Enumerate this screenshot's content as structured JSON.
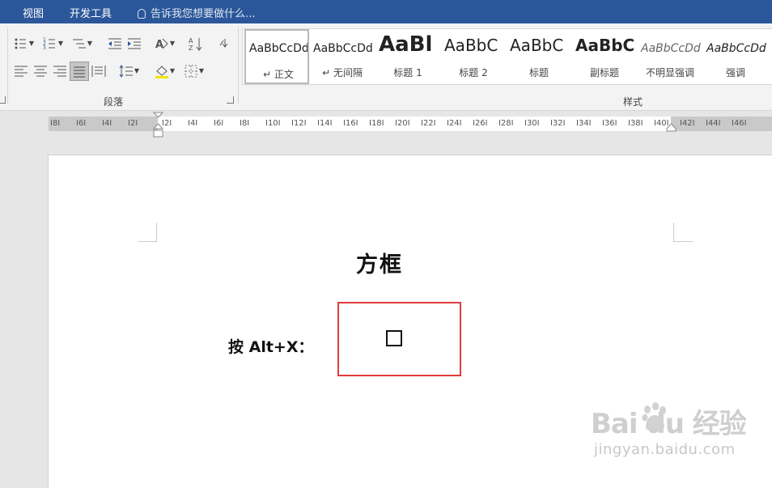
{
  "tabs": [
    "视图",
    "开发工具"
  ],
  "tell_me": "告诉我您想要做什么...",
  "ribbon": {
    "paragraph_group_label": "段落",
    "styles_group_label": "样式",
    "styles": [
      {
        "preview": "AaBbCcDd",
        "name": "↵ 正文",
        "selected": true
      },
      {
        "preview": "AaBbCcDd",
        "name": "↵ 无间隔"
      },
      {
        "preview": "AaBl",
        "name": "标题 1"
      },
      {
        "preview": "AaBbC",
        "name": "标题 2"
      },
      {
        "preview": "AaBbC",
        "name": "标题"
      },
      {
        "preview": "AaBbC",
        "name": "副标题"
      },
      {
        "preview": "AaBbCcDd",
        "name": "不明显强调"
      },
      {
        "preview": "AaBbCcDd",
        "name": "强调"
      }
    ]
  },
  "ruler": {
    "labels": [
      "8",
      "6",
      "4",
      "2",
      "2",
      "4",
      "6",
      "8",
      "10",
      "12",
      "14",
      "16",
      "18",
      "20",
      "22",
      "24",
      "26",
      "28",
      "30",
      "32",
      "34",
      "36",
      "38",
      "40",
      "42",
      "44",
      "46"
    ]
  },
  "document": {
    "title": "方框",
    "label": "按 Alt+X：",
    "symbol": "□"
  },
  "watermark": {
    "main": "Bai  du 经验",
    "sub": "jingyan.baidu.com"
  },
  "colors": {
    "tab_bar": "#2b579a",
    "highlight_border": "#e03c3c"
  }
}
